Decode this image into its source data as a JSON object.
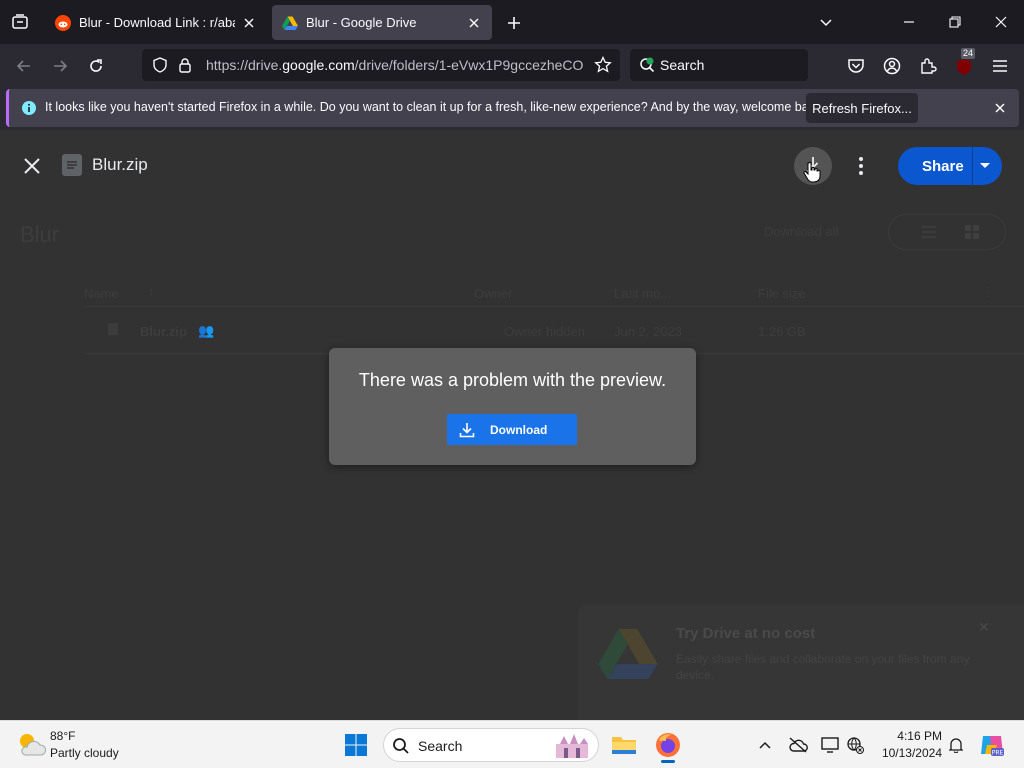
{
  "browser": {
    "tabs": [
      {
        "title": "Blur - Download Link : r/abandonware",
        "favicon": "reddit-icon",
        "active": false
      },
      {
        "title": "Blur - Google Drive",
        "favicon": "google-drive-icon",
        "active": true
      }
    ],
    "url_prefix": "https://drive.",
    "url_domain": "google.com",
    "url_path": "/drive/folders/1-eVwx1P9gccezheCO",
    "search_placeholder": "Search",
    "badge_count": "24"
  },
  "notification": {
    "message": "It looks like you haven't started Firefox in a while. Do you want to clean it up for a fresh, like-new experience? And by the way, welcome back!",
    "button_label": "Refresh Firefox..."
  },
  "viewer": {
    "file_name": "Blur.zip",
    "share_label": "Share"
  },
  "drive_background": {
    "folder_name": "Blur",
    "download_all": "Download all",
    "columns": [
      "Name",
      "Owner",
      "Last mo...",
      "File size"
    ],
    "row": {
      "name": "Blur.zip",
      "owner": "Owner hidden",
      "modified": "Jun 2, 2023",
      "size": "1.26 GB"
    },
    "promo_title": "Try Drive at no cost",
    "promo_text": "Easily share files and collaborate on your files from any device."
  },
  "dialog": {
    "message": "There was a problem with the preview.",
    "button_label": "Download"
  },
  "taskbar": {
    "temperature": "88°F",
    "weather": "Partly cloudy",
    "search_placeholder": "Search",
    "time": "4:16 PM",
    "date": "10/13/2024"
  },
  "colors": {
    "accent_blue": "#1a73e8",
    "share_blue": "#0b57d0",
    "firefox_dark": "#1c1b22",
    "notif_accent": "#b86cf8"
  }
}
